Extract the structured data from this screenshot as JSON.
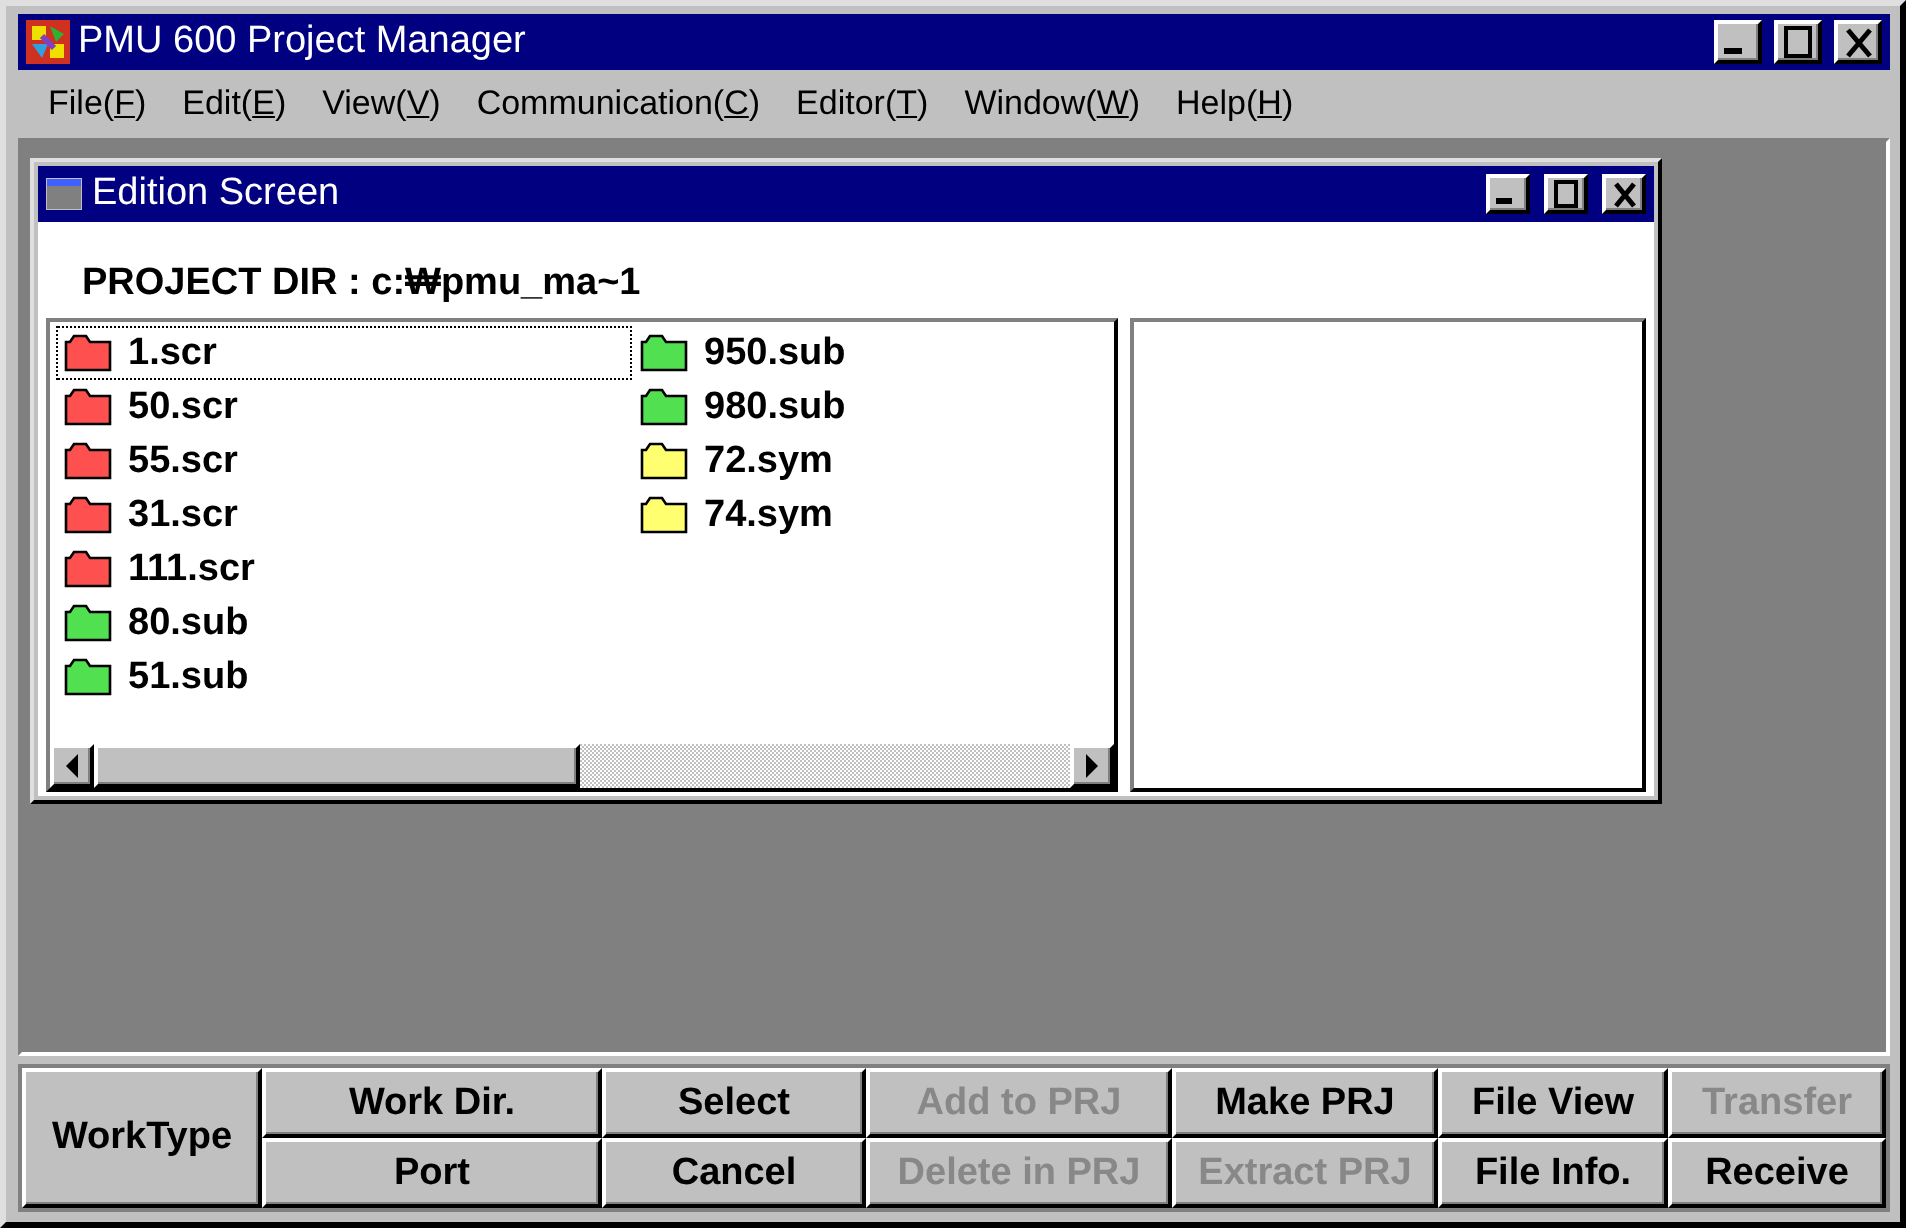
{
  "window": {
    "title": "PMU 600 Project Manager"
  },
  "menu": [
    {
      "before": "File(",
      "key": "F",
      "after": ")"
    },
    {
      "before": "Edit(",
      "key": "E",
      "after": ")"
    },
    {
      "before": "View(",
      "key": "V",
      "after": ")"
    },
    {
      "before": "Communication(",
      "key": "C",
      "after": ")"
    },
    {
      "before": "Editor(",
      "key": "T",
      "after": ")"
    },
    {
      "before": "Window(",
      "key": "W",
      "after": ")"
    },
    {
      "before": "Help(",
      "key": "H",
      "after": ")"
    }
  ],
  "child_window": {
    "title": "Edition Screen",
    "project_dir": "PROJECT DIR : c:₩pmu_ma~1",
    "files": [
      {
        "name": "1.scr",
        "color": "#ff5050",
        "selected": true
      },
      {
        "name": "50.scr",
        "color": "#ff5050",
        "selected": false
      },
      {
        "name": "55.scr",
        "color": "#ff5050",
        "selected": false
      },
      {
        "name": "31.scr",
        "color": "#ff5050",
        "selected": false
      },
      {
        "name": "111.scr",
        "color": "#ff5050",
        "selected": false
      },
      {
        "name": "80.sub",
        "color": "#50e050",
        "selected": false
      },
      {
        "name": "51.sub",
        "color": "#50e050",
        "selected": false
      },
      {
        "name": "950.sub",
        "color": "#50e050",
        "selected": false
      },
      {
        "name": "980.sub",
        "color": "#50e050",
        "selected": false
      },
      {
        "name": "72.sym",
        "color": "#ffff70",
        "selected": false
      },
      {
        "name": "74.sym",
        "color": "#ffff70",
        "selected": false
      }
    ]
  },
  "work_type": "WorkType",
  "buttons": [
    [
      {
        "label": "Work Dir.",
        "disabled": false
      },
      {
        "label": "Select",
        "disabled": false
      },
      {
        "label": "Add to PRJ",
        "disabled": true
      },
      {
        "label": "Make PRJ",
        "disabled": false
      },
      {
        "label": "File View",
        "disabled": false
      },
      {
        "label": "Transfer",
        "disabled": true
      }
    ],
    [
      {
        "label": "Port",
        "disabled": false
      },
      {
        "label": "Cancel",
        "disabled": false
      },
      {
        "label": "Delete in PRJ",
        "disabled": true
      },
      {
        "label": "Extract PRJ",
        "disabled": true
      },
      {
        "label": "File Info.",
        "disabled": false
      },
      {
        "label": "Receive",
        "disabled": false
      }
    ]
  ]
}
